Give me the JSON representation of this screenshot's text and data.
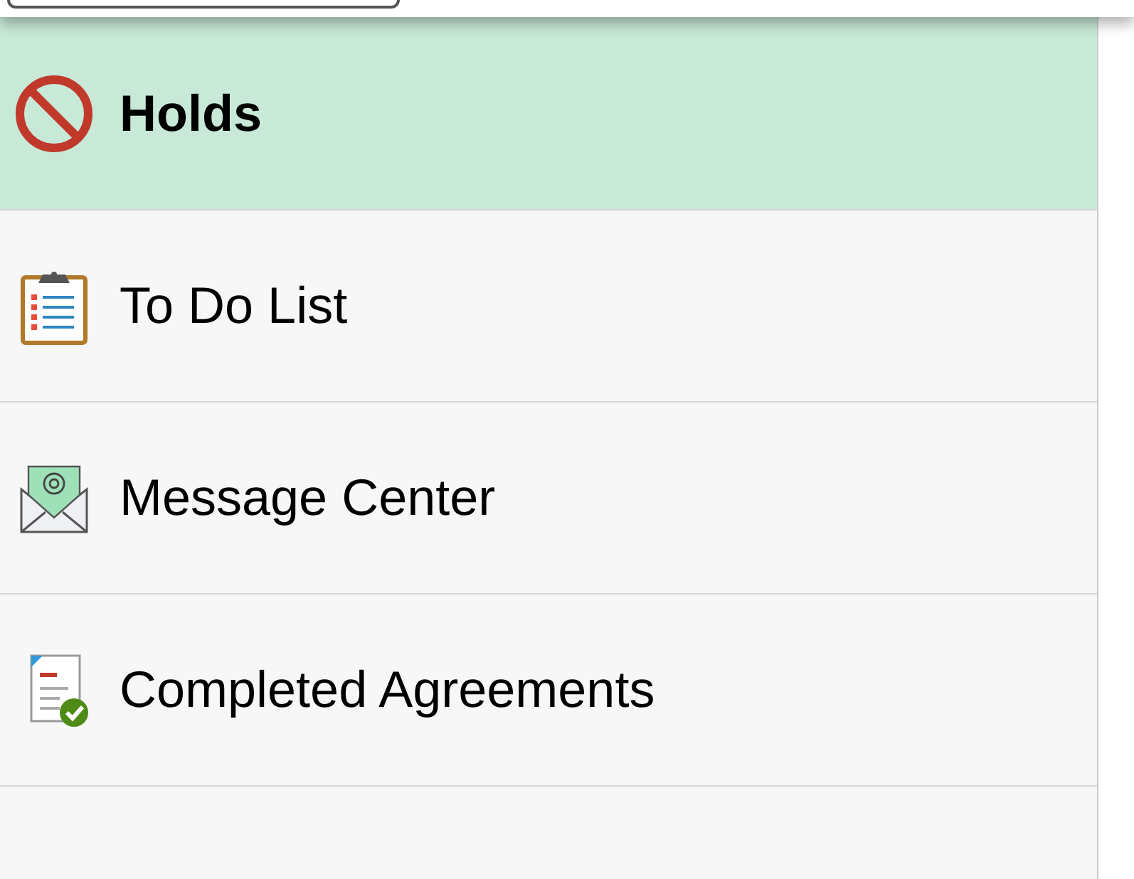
{
  "menu": [
    {
      "label": "Holds",
      "kind": "holds",
      "selected": true
    },
    {
      "label": "To Do List",
      "kind": "todo",
      "selected": false
    },
    {
      "label": "Message Center",
      "kind": "message",
      "selected": false
    },
    {
      "label": "Completed Agreements",
      "kind": "agreements",
      "selected": false
    }
  ]
}
